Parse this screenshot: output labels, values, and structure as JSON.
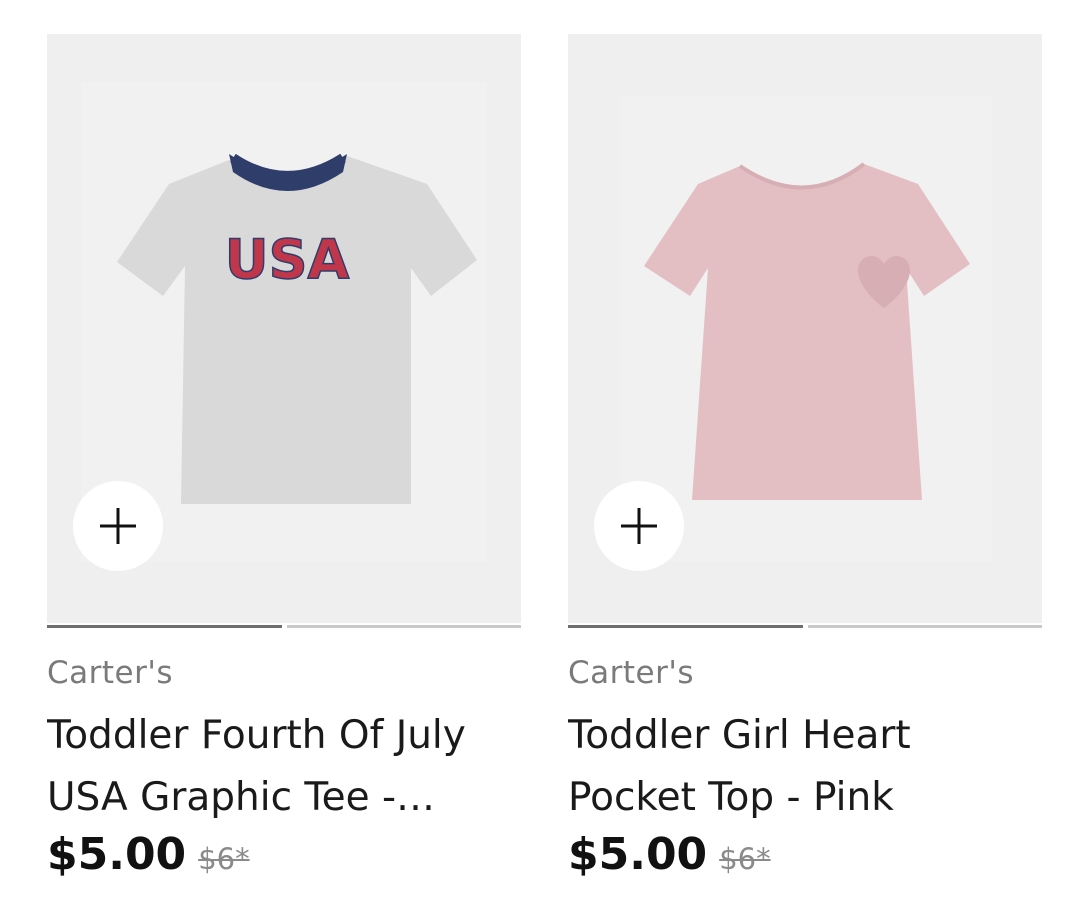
{
  "products": [
    {
      "brand": "Carter's",
      "title": "Toddler Fourth Of July USA Graphic Tee -…",
      "price": "$5.00",
      "old_price": "$6*",
      "shirt_text": "USA",
      "shirt_color": "#dcdcdc",
      "collar_color": "#2f3d6b"
    },
    {
      "brand": "Carter's",
      "title": "Toddler Girl Heart Pocket Top - Pink",
      "price": "$5.00",
      "old_price": "$6*",
      "shirt_color": "#e3bfc3",
      "collar_color": "#e3bfc3"
    }
  ],
  "colors": {
    "card_bg": "#efefef",
    "progress_active": "#6e6e6e",
    "progress_inactive": "#c9c9c9"
  }
}
